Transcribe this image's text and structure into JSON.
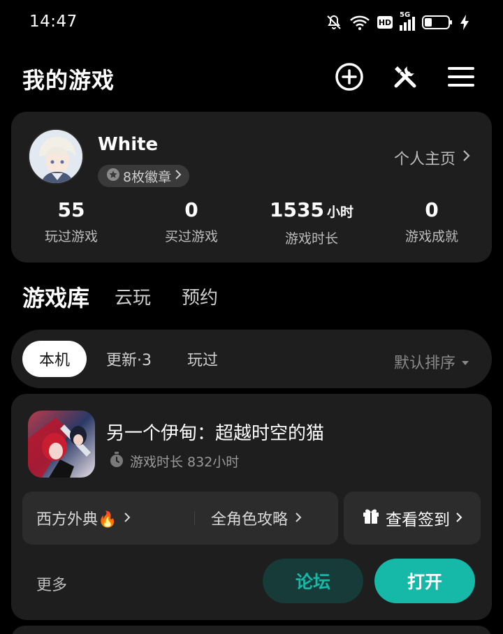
{
  "status_bar": {
    "time": "14:47",
    "icons": [
      "mute-icon",
      "wifi-icon",
      "hd-icon",
      "5g-signal-icon",
      "battery-icon",
      "charging-icon"
    ],
    "hd_label": "HD",
    "network_label": "5G"
  },
  "header": {
    "title": "我的游戏",
    "icons": [
      "add-circle-icon",
      "tools-icon",
      "menu-icon"
    ]
  },
  "profile": {
    "username": "White",
    "badges_label": "8枚徽章",
    "homepage_link": "个人主页",
    "stats": [
      {
        "value": "55",
        "unit": "",
        "label": "玩过游戏"
      },
      {
        "value": "0",
        "unit": "",
        "label": "买过游戏"
      },
      {
        "value": "1535",
        "unit": "小时",
        "label": "游戏时长"
      },
      {
        "value": "0",
        "unit": "",
        "label": "游戏成就"
      }
    ]
  },
  "library_tabs": [
    {
      "label": "游戏库",
      "active": true
    },
    {
      "label": "云玩",
      "active": false
    },
    {
      "label": "预约",
      "active": false
    }
  ],
  "filters": {
    "chips": [
      {
        "label": "本机",
        "active": true
      },
      {
        "label": "更新·3",
        "active": false
      },
      {
        "label": "玩过",
        "active": false
      }
    ],
    "sort_label": "默认排序"
  },
  "game": {
    "title": "另一个伊甸：超越时空的猫",
    "playtime": "游戏时长 832小时",
    "guide_left": "西方外典🔥",
    "guide_right": "全角色攻略",
    "checkin": "查看签到",
    "more": "更多",
    "forum_button": "论坛",
    "open_button": "打开"
  },
  "colors": {
    "accent": "#16b9a8",
    "accent_dark": "#173b38",
    "card_bg": "#1e1e1e",
    "inner_bg": "#2c2c2c",
    "background": "#000000"
  }
}
